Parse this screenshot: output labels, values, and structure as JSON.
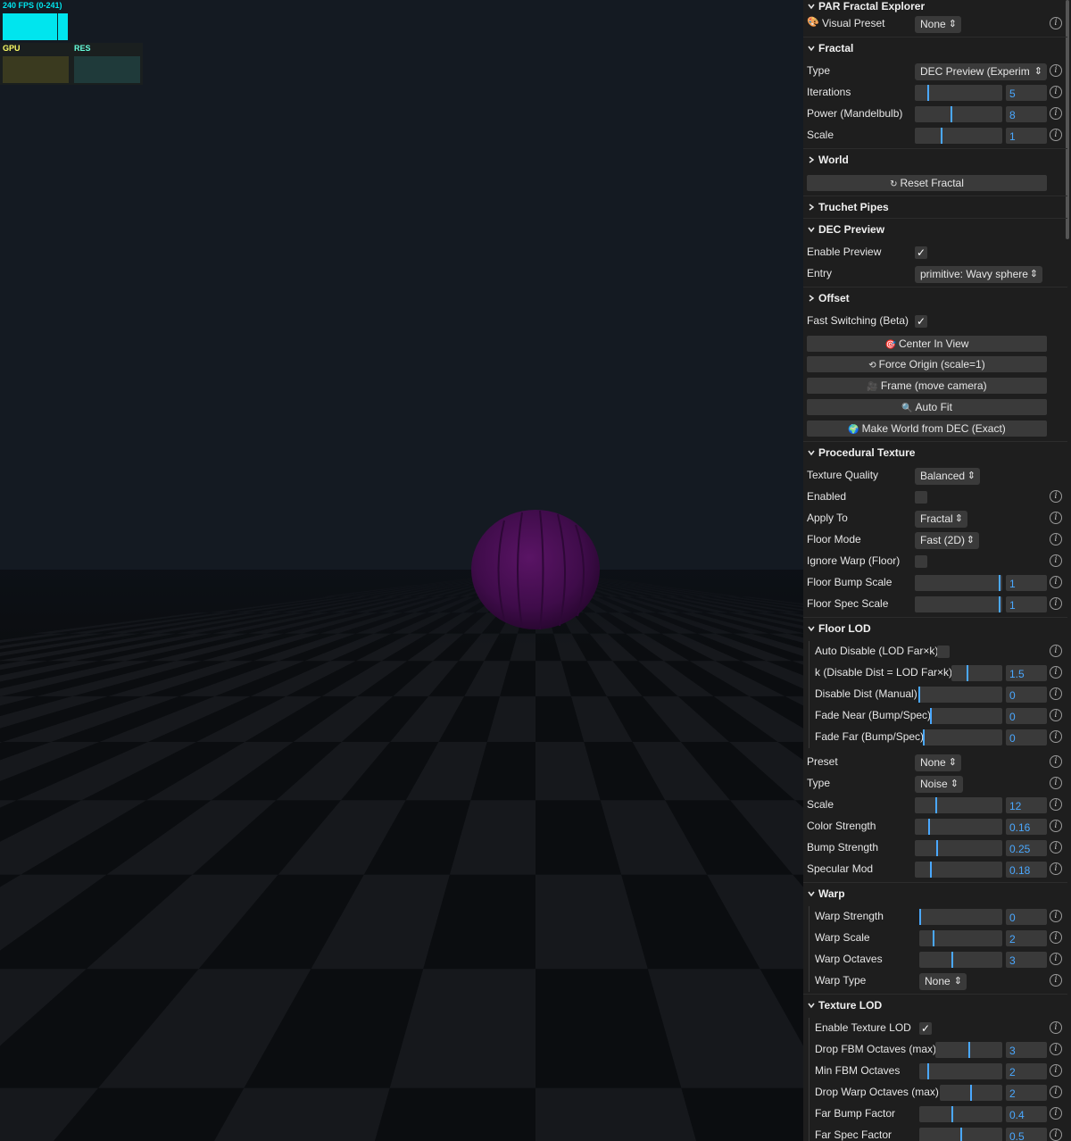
{
  "stats": {
    "fps_label": "240 FPS (0-241)",
    "gpu_label": "GPU",
    "res_label": "RES",
    "colors": {
      "fps": "#00e5ee",
      "gpu": "#ffff66",
      "res": "#66ffdd"
    }
  },
  "panel": {
    "title": "PAR Fractal Explorer",
    "visual_preset": {
      "label": "Visual Preset",
      "icon": "palette-icon",
      "value": "None"
    },
    "fractal": {
      "title": "Fractal",
      "type": {
        "label": "Type",
        "value": "DEC Preview (Experim"
      },
      "iterations": {
        "label": "Iterations",
        "value": "5",
        "level": 0.15
      },
      "power": {
        "label": "Power (Mandelbulb)",
        "value": "8",
        "level": 0.42
      },
      "scale": {
        "label": "Scale",
        "value": "1",
        "level": 0.3
      }
    },
    "world": {
      "title": "World"
    },
    "reset_button": "Reset Fractal",
    "truchet": {
      "title": "Truchet Pipes"
    },
    "dec_preview": {
      "title": "DEC Preview",
      "enable": {
        "label": "Enable Preview",
        "checked": true
      },
      "entry": {
        "label": "Entry",
        "value": "primitive: Wavy sphere"
      },
      "offset_title": "Offset",
      "fast_switching": {
        "label": "Fast Switching (Beta)",
        "checked": true
      },
      "buttons": [
        "Center In View",
        "Force Origin (scale=1)",
        "Frame (move camera)",
        "Auto Fit",
        "Make World from DEC (Exact)"
      ]
    },
    "procedural_texture": {
      "title": "Procedural Texture",
      "texture_quality": {
        "label": "Texture Quality",
        "value": "Balanced"
      },
      "enabled": {
        "label": "Enabled",
        "checked": false
      },
      "apply_to": {
        "label": "Apply To",
        "value": "Fractal"
      },
      "floor_mode": {
        "label": "Floor Mode",
        "value": "Fast (2D)"
      },
      "ignore_warp": {
        "label": "Ignore Warp (Floor)",
        "checked": false
      },
      "floor_bump_scale": {
        "label": "Floor Bump Scale",
        "value": "1",
        "level": 0.98
      },
      "floor_spec_scale": {
        "label": "Floor Spec Scale",
        "value": "1",
        "level": 0.98
      }
    },
    "floor_lod": {
      "title": "Floor LOD",
      "auto_disable": {
        "label": "Auto Disable (LOD Far×k)",
        "checked": false
      },
      "k": {
        "label": "k (Disable Dist = LOD Far×k)",
        "value": "1.5",
        "level": 0.3
      },
      "disable_dist": {
        "label": "Disable Dist (Manual)",
        "value": "0",
        "level": 0.0
      },
      "fade_near": {
        "label": "Fade Near (Bump/Spec)",
        "value": "0",
        "level": 0.0
      },
      "fade_far": {
        "label": "Fade Far (Bump/Spec)",
        "value": "0",
        "level": 0.0
      }
    },
    "texture_params": {
      "preset": {
        "label": "Preset",
        "value": "None"
      },
      "type": {
        "label": "Type",
        "value": "Noise"
      },
      "scale": {
        "label": "Scale",
        "value": "12",
        "level": 0.24
      },
      "color_strength": {
        "label": "Color Strength",
        "value": "0.16",
        "level": 0.16
      },
      "bump_strength": {
        "label": "Bump Strength",
        "value": "0.25",
        "level": 0.25
      },
      "specular_mod": {
        "label": "Specular Mod",
        "value": "0.18",
        "level": 0.18
      }
    },
    "warp": {
      "title": "Warp",
      "strength": {
        "label": "Warp Strength",
        "value": "0",
        "level": 0.0
      },
      "scale": {
        "label": "Warp Scale",
        "value": "2",
        "level": 0.16
      },
      "octaves": {
        "label": "Warp Octaves",
        "value": "3",
        "level": 0.4
      },
      "type": {
        "label": "Warp Type",
        "value": "None"
      }
    },
    "texture_lod": {
      "title": "Texture LOD",
      "enable": {
        "label": "Enable Texture LOD",
        "checked": true
      },
      "drop_fbm": {
        "label": "Drop FBM Octaves (max)",
        "value": "3",
        "level": 0.5
      },
      "min_fbm": {
        "label": "Min FBM Octaves",
        "value": "2",
        "level": 0.1
      },
      "drop_warp": {
        "label": "Drop Warp Octaves (max)",
        "value": "2",
        "level": 0.5
      },
      "far_bump": {
        "label": "Far Bump Factor",
        "value": "0.4",
        "level": 0.4
      },
      "far_spec": {
        "label": "Far Spec Factor",
        "value": "0.5",
        "level": 0.5
      }
    }
  }
}
